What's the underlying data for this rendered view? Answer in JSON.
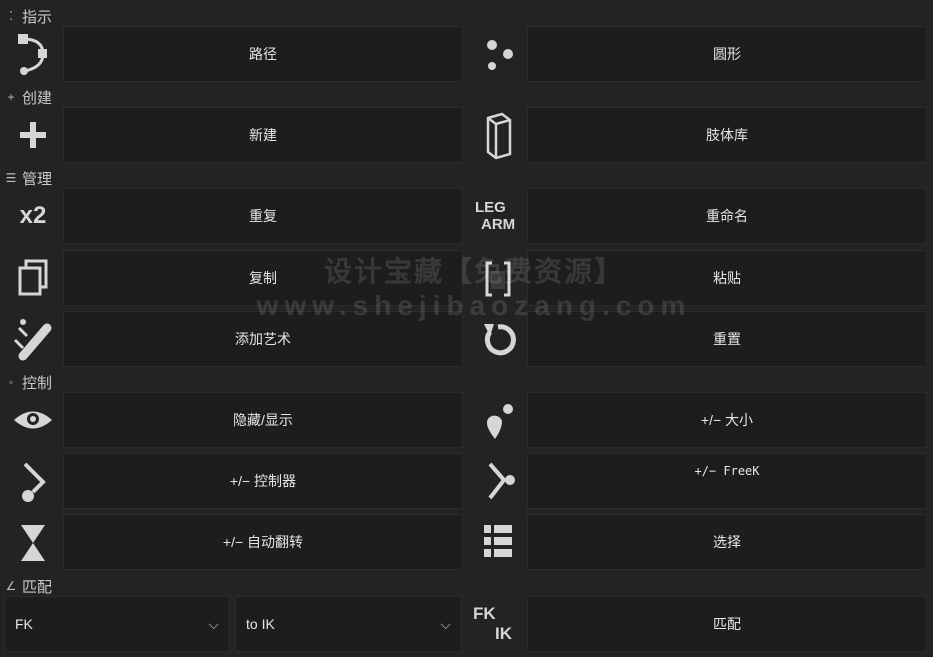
{
  "sections": {
    "indicate": "指示",
    "create": "创建",
    "manage": "管理",
    "control": "控制",
    "match": "匹配"
  },
  "buttons": {
    "path": "路径",
    "circle": "圆形",
    "new": "新建",
    "limb_library": "肢体库",
    "duplicate": "重复",
    "rename": "重命名",
    "copy": "复制",
    "paste": "粘贴",
    "add_art": "添加艺术",
    "reset": "重置",
    "hide_show": "隐藏/显示",
    "size": "+/− 大小",
    "controller": "+/− 控制器",
    "freek": "+/− FreeK",
    "auto_flip": "+/− 自动翻转",
    "select": "选择",
    "match": "匹配"
  },
  "icons": {
    "x2": "x2",
    "leg": "LEG",
    "arm": "ARM",
    "fk": "FK",
    "ik": "IK"
  },
  "dropdowns": {
    "from": "FK",
    "to": "to IK"
  },
  "watermark": {
    "line1": "设计宝藏【免费资源】",
    "line2": "www.shejibaozang.com"
  }
}
